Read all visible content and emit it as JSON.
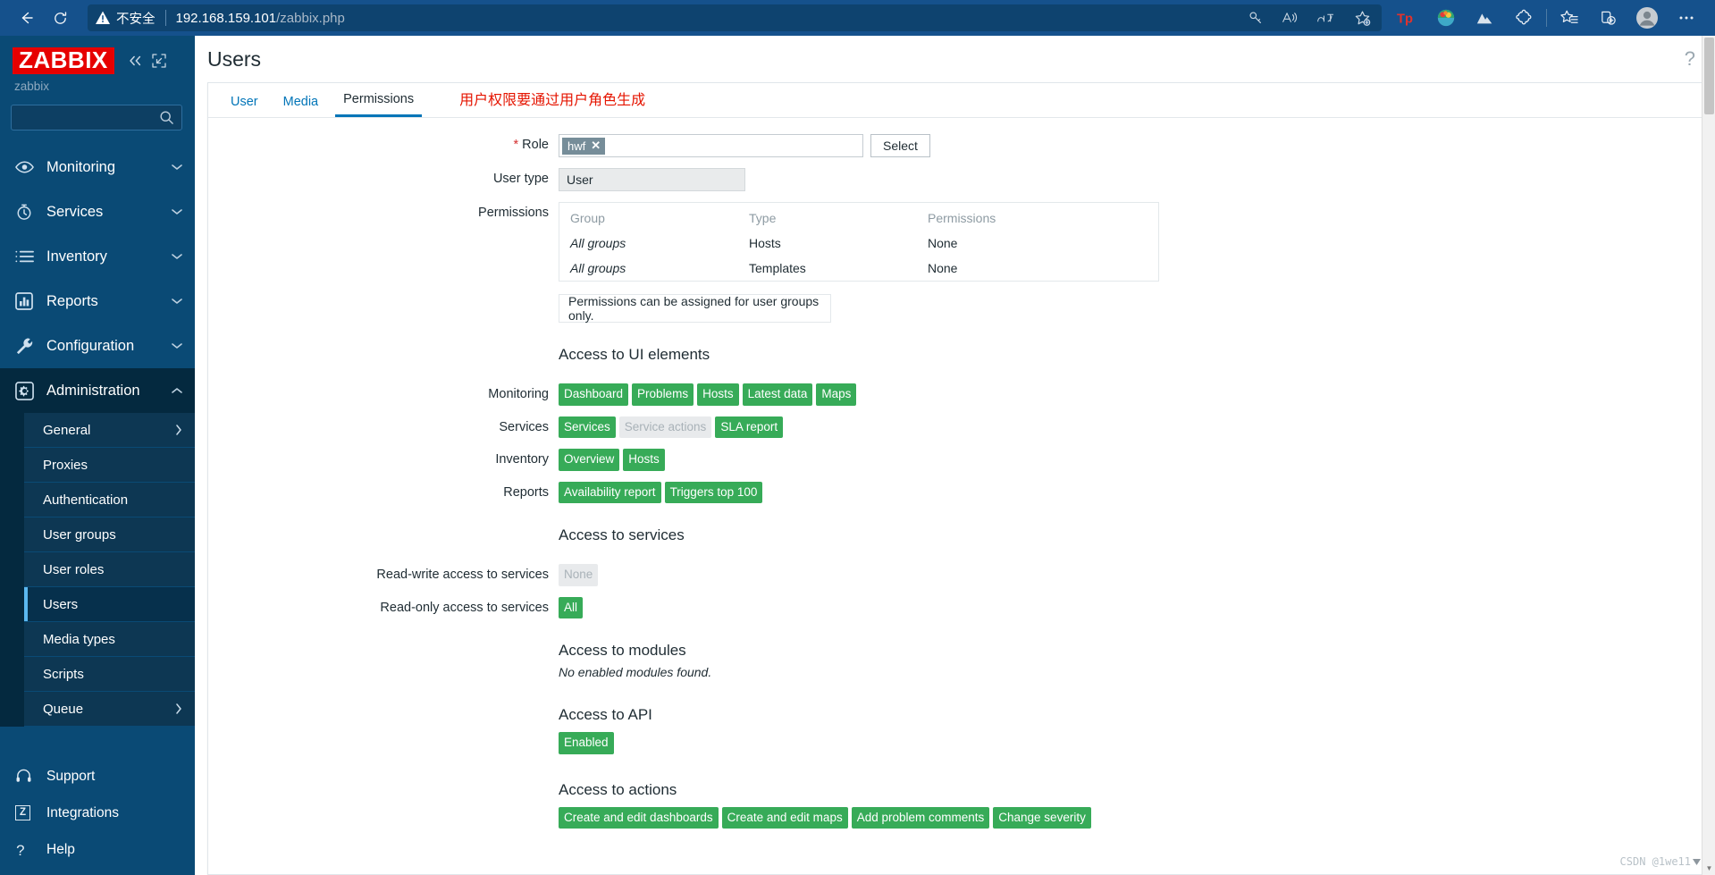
{
  "browser": {
    "back_icon": "back-arrow-icon",
    "reload_icon": "reload-icon",
    "security_label": "不安全",
    "url_host": "192.168.159.101",
    "url_path": "/zabbix.php",
    "omni_icons": [
      "key-icon",
      "read-aloud-icon",
      "translate-icon",
      "add-favorite-icon"
    ],
    "toolbar_icons": [
      "tp-extension-icon",
      "colorful-extension-icon",
      "mountain-extension-icon",
      "puzzle-extension-icon",
      "favorites-icon",
      "collections-icon",
      "profile-avatar-icon",
      "settings-more-icon"
    ]
  },
  "sidebar": {
    "logo": "ZABBIX",
    "server_name": "zabbix",
    "collapse_icon": "collapse-sidebar-icon",
    "hide_icon": "hide-sidebar-icon",
    "search_placeholder": "",
    "search_value": "",
    "nav": [
      {
        "label": "Monitoring",
        "icon": "eye-icon",
        "chevron": "chevron-down",
        "active": false
      },
      {
        "label": "Services",
        "icon": "clock-icon",
        "chevron": "chevron-down",
        "active": false
      },
      {
        "label": "Inventory",
        "icon": "list-icon",
        "chevron": "chevron-down",
        "active": false
      },
      {
        "label": "Reports",
        "icon": "barchart-icon",
        "chevron": "chevron-down",
        "active": false
      },
      {
        "label": "Configuration",
        "icon": "wrench-icon",
        "chevron": "chevron-down",
        "active": false
      },
      {
        "label": "Administration",
        "icon": "gear-icon",
        "chevron": "chevron-up",
        "active": true
      }
    ],
    "submenu": [
      {
        "label": "General",
        "chevron": "chevron-right",
        "selected": false
      },
      {
        "label": "Proxies",
        "chevron": "",
        "selected": false
      },
      {
        "label": "Authentication",
        "chevron": "",
        "selected": false
      },
      {
        "label": "User groups",
        "chevron": "",
        "selected": false
      },
      {
        "label": "User roles",
        "chevron": "",
        "selected": false
      },
      {
        "label": "Users",
        "chevron": "",
        "selected": true
      },
      {
        "label": "Media types",
        "chevron": "",
        "selected": false
      },
      {
        "label": "Scripts",
        "chevron": "",
        "selected": false
      },
      {
        "label": "Queue",
        "chevron": "chevron-right",
        "selected": false
      }
    ],
    "bottom": [
      {
        "label": "Support",
        "icon": "headset-icon"
      },
      {
        "label": "Integrations",
        "icon": "z-square-icon"
      },
      {
        "label": "Help",
        "icon": "question-icon"
      }
    ]
  },
  "page": {
    "title": "Users",
    "help_icon": "question-mark-icon"
  },
  "tabs": [
    {
      "label": "User",
      "active": false
    },
    {
      "label": "Media",
      "active": false
    },
    {
      "label": "Permissions",
      "active": true
    }
  ],
  "annotation": "用户权限要通过用户角色生成",
  "form": {
    "role": {
      "label": "Role",
      "required_marker": "*",
      "chip": "hwf",
      "chip_remove": "✕",
      "select_button": "Select"
    },
    "user_type": {
      "label": "User type",
      "value": "User"
    },
    "permissions": {
      "label": "Permissions",
      "columns": [
        "Group",
        "Type",
        "Permissions"
      ],
      "rows": [
        {
          "group": "All groups",
          "type": "Hosts",
          "permission": "None"
        },
        {
          "group": "All groups",
          "type": "Templates",
          "permission": "None"
        }
      ],
      "note": "Permissions can be assigned for user groups only."
    }
  },
  "ui_elements": {
    "heading": "Access to UI elements",
    "rows": [
      {
        "label": "Monitoring",
        "badges": [
          {
            "text": "Dashboard",
            "enabled": true
          },
          {
            "text": "Problems",
            "enabled": true
          },
          {
            "text": "Hosts",
            "enabled": true
          },
          {
            "text": "Latest data",
            "enabled": true
          },
          {
            "text": "Maps",
            "enabled": true
          }
        ]
      },
      {
        "label": "Services",
        "badges": [
          {
            "text": "Services",
            "enabled": true
          },
          {
            "text": "Service actions",
            "enabled": false
          },
          {
            "text": "SLA report",
            "enabled": true
          }
        ]
      },
      {
        "label": "Inventory",
        "badges": [
          {
            "text": "Overview",
            "enabled": true
          },
          {
            "text": "Hosts",
            "enabled": true
          }
        ]
      },
      {
        "label": "Reports",
        "badges": [
          {
            "text": "Availability report",
            "enabled": true
          },
          {
            "text": "Triggers top 100",
            "enabled": true
          }
        ]
      }
    ]
  },
  "services_access": {
    "heading": "Access to services",
    "rows": [
      {
        "label": "Read-write access to services",
        "badge": {
          "text": "None",
          "enabled": false
        }
      },
      {
        "label": "Read-only access to services",
        "badge": {
          "text": "All",
          "enabled": true
        }
      }
    ]
  },
  "modules_access": {
    "heading": "Access to modules",
    "note": "No enabled modules found."
  },
  "api_access": {
    "heading": "Access to API",
    "badge": {
      "text": "Enabled",
      "enabled": true
    }
  },
  "actions_access": {
    "heading": "Access to actions",
    "badges": [
      {
        "text": "Create and edit dashboards",
        "enabled": true
      },
      {
        "text": "Create and edit maps",
        "enabled": true
      },
      {
        "text": "Add problem comments",
        "enabled": true
      },
      {
        "text": "Change severity",
        "enabled": true
      }
    ]
  },
  "watermark": "CSDN @1we11",
  "colors": {
    "brand_red": "#e60000",
    "sidebar_bg": "#0a4a75",
    "badge_green": "#37ab58",
    "badge_disabled": "#e8eaec",
    "link_blue": "#0275b8",
    "annotation_red": "#e51400"
  }
}
